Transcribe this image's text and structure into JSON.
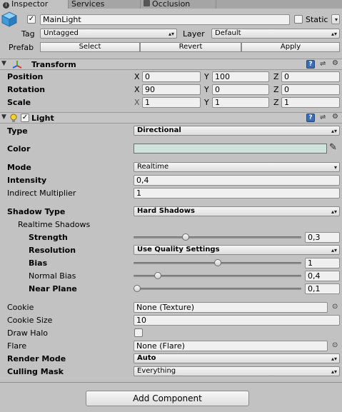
{
  "tabs": [
    {
      "label": "Inspector",
      "icon": "info-icon"
    },
    {
      "label": "Services",
      "icon": ""
    },
    {
      "label": "Occlusion",
      "icon": "occlusion-icon"
    }
  ],
  "object": {
    "name": "MainLight",
    "active": true,
    "static_label": "Static",
    "static_checked": false,
    "tag_label": "Tag",
    "tag_value": "Untagged",
    "layer_label": "Layer",
    "layer_value": "Default",
    "prefab_label": "Prefab",
    "prefab_buttons": [
      "Select",
      "Revert",
      "Apply"
    ]
  },
  "transform": {
    "title": "Transform",
    "rows": [
      {
        "label": "Position",
        "x": "0",
        "y": "100",
        "z": "0"
      },
      {
        "label": "Rotation",
        "x": "90",
        "y": "0",
        "z": "0"
      },
      {
        "label": "Scale",
        "x": "1",
        "y": "1",
        "z": "1"
      }
    ],
    "axis_labels": [
      "X",
      "Y",
      "Z"
    ]
  },
  "light": {
    "title": "Light",
    "enabled": true,
    "type_label": "Type",
    "type_value": "Directional",
    "color_label": "Color",
    "color_value": "#cfe2dc",
    "mode_label": "Mode",
    "mode_value": "Realtime",
    "intensity_label": "Intensity",
    "intensity_value": "0,4",
    "indirect_label": "Indirect Multiplier",
    "indirect_value": "1",
    "shadow_type_label": "Shadow Type",
    "shadow_type_value": "Hard Shadows",
    "realtime_shadows_label": "Realtime Shadows",
    "strength_label": "Strength",
    "strength_value": "0,3",
    "strength_fraction": 0.3,
    "resolution_label": "Resolution",
    "resolution_value": "Use Quality Settings",
    "bias_label": "Bias",
    "bias_value": "1",
    "bias_fraction": 0.5,
    "normal_bias_label": "Normal Bias",
    "normal_bias_value": "0,4",
    "normal_bias_fraction": 0.13,
    "near_plane_label": "Near Plane",
    "near_plane_value": "0,1",
    "near_plane_fraction": 0.0,
    "cookie_label": "Cookie",
    "cookie_value": "None (Texture)",
    "cookie_size_label": "Cookie Size",
    "cookie_size_value": "10",
    "draw_halo_label": "Draw Halo",
    "draw_halo_checked": false,
    "flare_label": "Flare",
    "flare_value": "None (Flare)",
    "render_mode_label": "Render Mode",
    "render_mode_value": "Auto",
    "culling_mask_label": "Culling Mask",
    "culling_mask_value": "Everything"
  },
  "add_component_label": "Add Component",
  "colors": {
    "panel_bg": "#c2c2c2",
    "help_blue": "#3a6db6"
  }
}
